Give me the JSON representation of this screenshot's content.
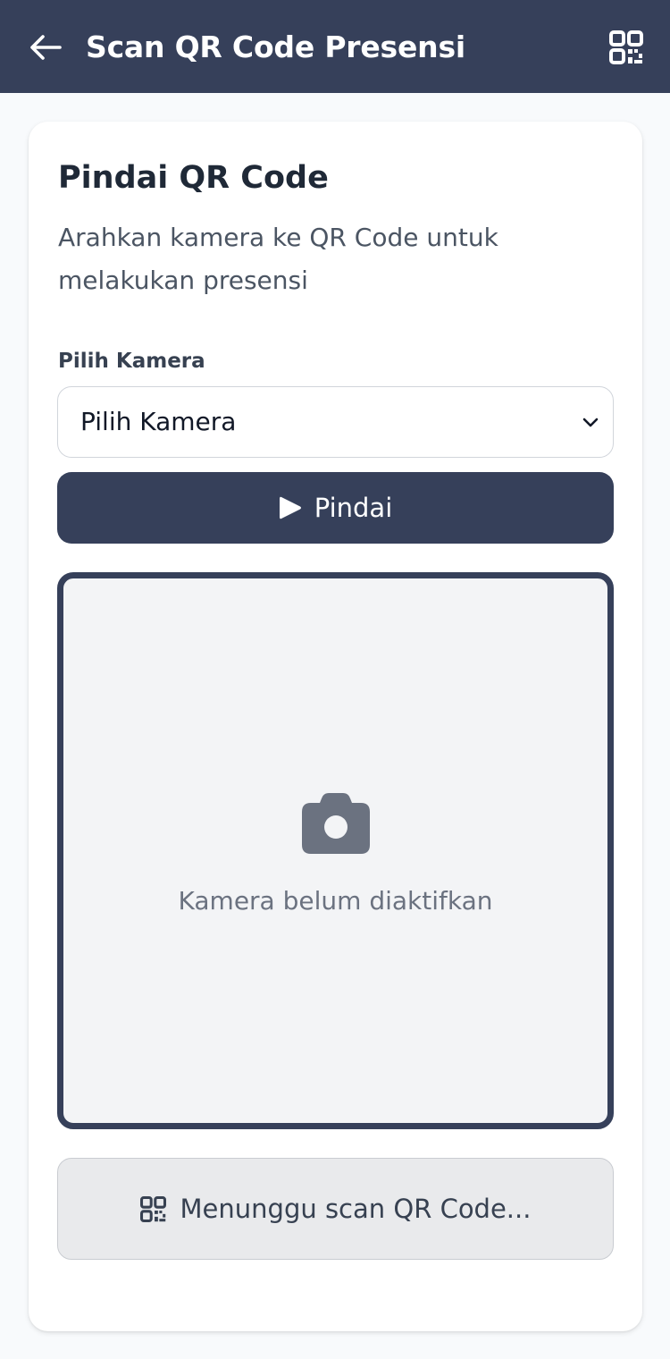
{
  "header": {
    "title": "Scan QR Code Presensi",
    "back_icon": "arrow-left-icon",
    "action_icon": "qrcode-icon",
    "bg_color": "#36405a"
  },
  "card": {
    "title": "Pindai QR Code",
    "description": "Arahkan kamera ke QR Code untuk melakukan presensi",
    "camera_label": "Pilih Kamera",
    "camera_select": {
      "selected": "Pilih Kamera"
    },
    "scan_button": {
      "label": "Pindai",
      "icon": "play-icon"
    },
    "camera_preview": {
      "icon": "camera-icon",
      "message": "Kamera belum diaktifkan"
    },
    "status": {
      "icon": "qrcode-icon",
      "text": "Menunggu scan QR Code..."
    }
  }
}
